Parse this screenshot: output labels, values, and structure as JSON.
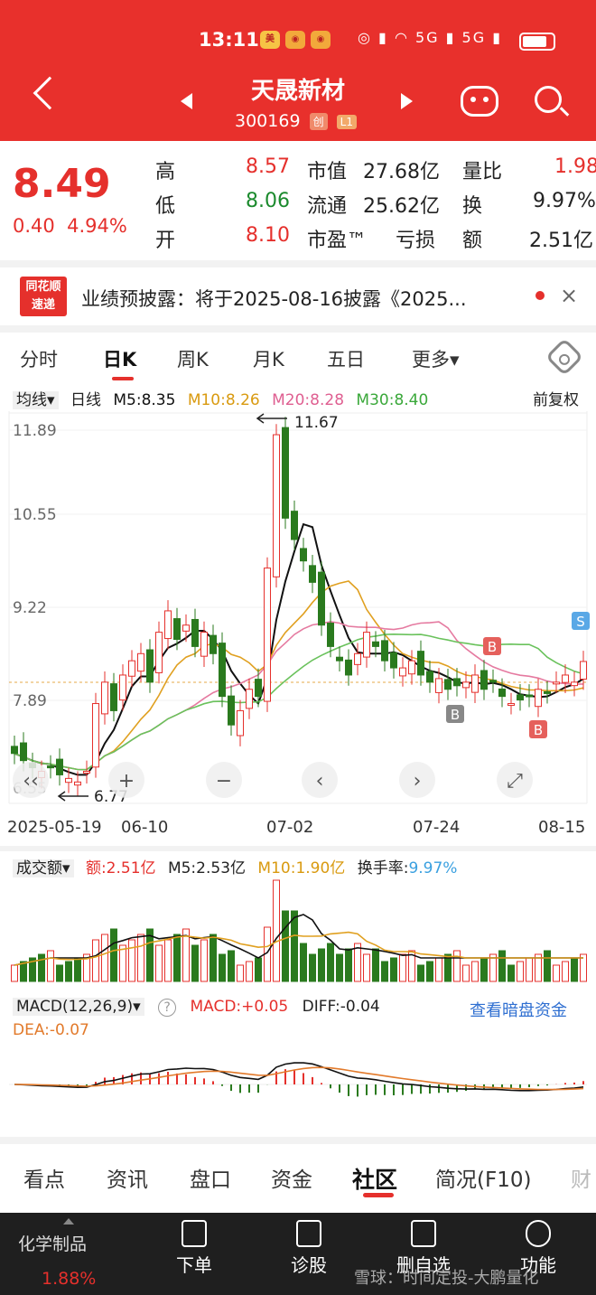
{
  "status": {
    "time": "13:11",
    "right": "◎ ▮ ◠ 5G ▮ 5G ▮"
  },
  "header": {
    "title": "天晟新材",
    "code": "300169",
    "badge1": "创",
    "badge2": "L1"
  },
  "quote": {
    "price": "8.49",
    "change": "0.40",
    "pct": "4.94%",
    "high_label": "高",
    "high": "8.57",
    "low_label": "低",
    "low": "8.06",
    "open_label": "开",
    "open": "8.10",
    "mcap_label": "市值",
    "mcap": "27.68亿",
    "float_label": "流通",
    "float": "25.62亿",
    "pe_label": "市盈™",
    "pe": "亏损",
    "vr_label": "量比",
    "vr": "1.98",
    "tr_label": "换",
    "tr": "9.97%",
    "amt_label": "额",
    "amt": "2.51亿"
  },
  "news": {
    "logo_top": "同花顺",
    "logo_bottom": "速递",
    "text": "业绩预披露：将于2025-08-16披露《2025...",
    "close": "×"
  },
  "period_tabs": [
    "分时",
    "日K",
    "周K",
    "月K",
    "五日",
    "更多▾"
  ],
  "ma": {
    "type": "均线▾",
    "period": "日线",
    "m5": "M5:8.35",
    "m10": "M10:8.26",
    "m20": "M20:8.28",
    "m30": "M30:8.40",
    "adjust": "前复权"
  },
  "chart_data": {
    "type": "candlestick",
    "y_ticks": [
      "11.89",
      "10.55",
      "9.22",
      "7.89",
      "6.55"
    ],
    "x_ticks": [
      "2025-05-19",
      "06-10",
      "07-02",
      "07-24",
      "08-15"
    ],
    "max_label": "11.67",
    "min_label": "6.77",
    "markers": [
      "B",
      "B",
      "B",
      "S"
    ],
    "colors": {
      "up": "#e5302c",
      "down": "#2a7a1e",
      "m5": "#111111",
      "m10": "#e0a020",
      "m20": "#e57aa0",
      "m30": "#6ac25c"
    }
  },
  "volume": {
    "label": "成交额▾",
    "amt": "额:2.51亿",
    "m5": "M5:2.53亿",
    "m10": "M10:1.90亿",
    "tr_label": "换手率:",
    "tr": "9.97%"
  },
  "macd": {
    "label": "MACD(12,26,9)▾",
    "help": "?",
    "macd": "MACD:+0.05",
    "diff": "DIFF:-0.04",
    "dea": "DEA:-0.07",
    "darkpool": "查看暗盘资金"
  },
  "bottom_tabs": [
    "看点",
    "资讯",
    "盘口",
    "资金",
    "社区",
    "简况(F10)",
    "财"
  ],
  "toolbar": {
    "sector": "化学制品",
    "sector_pct": "1.88%",
    "order": "下单",
    "diagnose": "诊股",
    "remove": "删自选",
    "func": "功能"
  },
  "watermark": "雪球：时间定投-大鹏量化",
  "chart_controls": [
    "‹‹",
    "+",
    "−",
    "‹",
    "›",
    "⤢"
  ]
}
